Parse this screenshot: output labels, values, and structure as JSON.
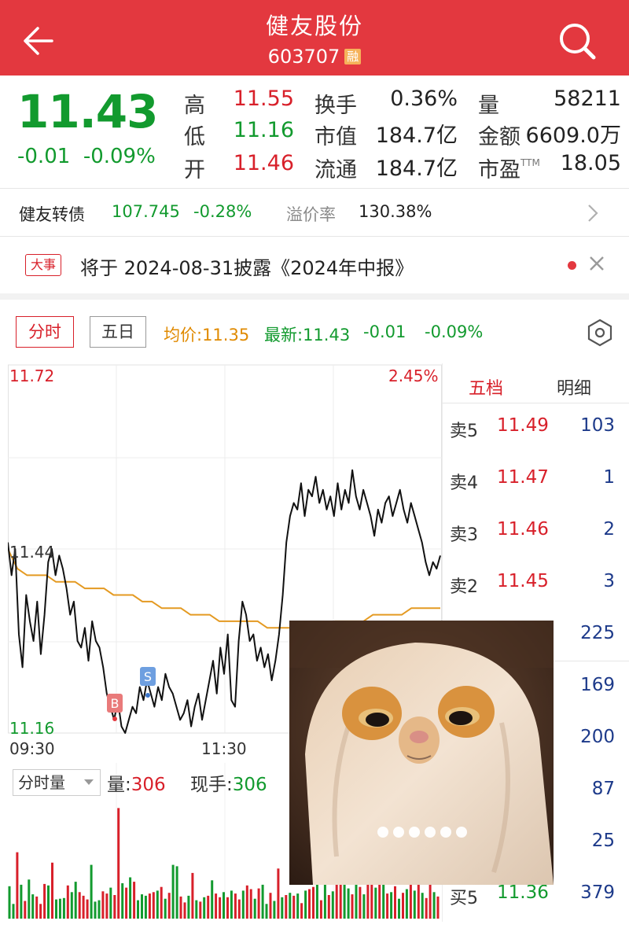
{
  "header": {
    "title": "健友股份",
    "code": "603707",
    "badge": "融"
  },
  "quote": {
    "price": "11.43",
    "change": "-0.01",
    "change_pct": "-0.09%",
    "stats": [
      {
        "label": "高",
        "value": "11.55",
        "color": "#d8202a"
      },
      {
        "label": "低",
        "value": "11.16",
        "color": "#129a2e"
      },
      {
        "label": "开",
        "value": "11.46",
        "color": "#d8202a"
      },
      {
        "label": "换手",
        "value": "0.36%",
        "color": "#222222"
      },
      {
        "label": "市值",
        "value": "184.7亿",
        "color": "#222222"
      },
      {
        "label": "流通",
        "value": "184.7亿",
        "color": "#222222"
      },
      {
        "label": "量",
        "value": "58211",
        "color": "#222222"
      },
      {
        "label": "金额",
        "value": "6609.0万",
        "color": "#222222"
      },
      {
        "label": "市盈",
        "value": "18.05",
        "color": "#222222",
        "sup": "TTM"
      }
    ]
  },
  "bond": {
    "name": "健友转债",
    "price": "107.745",
    "change_pct": "-0.28%",
    "premium_label": "溢价率",
    "premium": "130.38%"
  },
  "event": {
    "badge": "大事",
    "text": "将于 2024-08-31披露《2024年中报》"
  },
  "chart_tabs": {
    "intraday": "分时",
    "five_day": "五日",
    "avg_price": "均价:11.35",
    "latest": "最新:11.43",
    "latest_change": "-0.01",
    "latest_pct": "-0.09%"
  },
  "chart_labels": {
    "y_high": "11.72",
    "y_prev_close": "11.44",
    "y_low": "11.16",
    "pct_high": "2.45%",
    "time_start": "09:30",
    "time_mid": "11:30",
    "marker_buy": "B",
    "marker_sell": "S"
  },
  "volume": {
    "mode": "分时量",
    "vol_label": "量:",
    "vol_value": "306",
    "xianshou_label": "现手:",
    "xianshou_value": "306"
  },
  "order_book": {
    "tab_five": "五档",
    "tab_detail": "明细",
    "rows": [
      {
        "label": "卖5",
        "price": "11.49",
        "vol": "103",
        "color": "#d8202a"
      },
      {
        "label": "卖4",
        "price": "11.47",
        "vol": "1",
        "color": "#d8202a"
      },
      {
        "label": "卖3",
        "price": "11.46",
        "vol": "2",
        "color": "#d8202a"
      },
      {
        "label": "卖2",
        "price": "11.45",
        "vol": "3",
        "color": "#d8202a"
      },
      {
        "label": "",
        "price": "",
        "vol": "225",
        "color": "#d8202a"
      },
      {
        "label": "",
        "price": "",
        "vol": "169",
        "color": "#129a2e"
      },
      {
        "label": "",
        "price": "",
        "vol": "200",
        "color": "#129a2e"
      },
      {
        "label": "",
        "price": "",
        "vol": "87",
        "color": "#129a2e"
      },
      {
        "label": "",
        "price": "",
        "vol": "25",
        "color": "#129a2e"
      },
      {
        "label": "买5",
        "price": "11.36",
        "vol": "379",
        "color": "#129a2e"
      }
    ]
  },
  "chart_data": {
    "type": "line",
    "ylim": [
      11.16,
      11.72
    ],
    "prev_close": 11.44,
    "series": [
      {
        "name": "",
        "color": "#111111",
        "values": [
          11.45,
          11.4,
          11.44,
          11.31,
          11.26,
          11.37,
          11.33,
          11.3,
          11.36,
          11.28,
          11.34,
          11.42,
          11.44,
          11.4,
          11.43,
          11.41,
          11.38,
          11.34,
          11.36,
          11.3,
          11.29,
          11.32,
          11.27,
          11.33,
          11.3,
          11.29,
          11.26,
          11.22,
          11.2,
          11.18,
          11.21,
          11.17,
          11.16,
          11.18,
          11.2,
          11.19,
          11.23,
          11.21,
          11.24,
          11.22,
          11.2,
          11.23,
          11.21,
          11.25,
          11.23,
          11.22,
          11.2,
          11.18,
          11.19,
          11.21,
          11.17,
          11.2,
          11.22,
          11.18,
          11.21,
          11.24,
          11.27,
          11.22,
          11.29,
          11.25,
          11.31,
          11.21,
          11.2,
          11.3,
          11.36,
          11.34,
          11.3,
          11.31,
          11.27,
          11.29,
          11.26,
          11.28,
          11.24,
          11.27,
          11.31,
          11.37,
          11.45,
          11.49,
          11.51,
          11.5,
          11.54,
          11.49,
          11.53,
          11.52,
          11.55,
          11.51,
          11.53,
          11.5,
          11.52,
          11.49,
          11.54,
          11.5,
          11.53,
          11.51,
          11.56,
          11.52,
          11.5,
          11.53,
          11.51,
          11.49,
          11.46,
          11.5,
          11.48,
          11.51,
          11.52,
          11.49,
          11.51,
          11.53,
          11.5,
          11.48,
          11.51,
          11.49,
          11.47,
          11.45,
          11.42,
          11.4,
          11.42,
          11.41,
          11.43
        ]
      },
      {
        "name": "",
        "color": "#e49a22",
        "values": [
          11.44,
          11.41,
          11.4,
          11.4,
          11.4,
          11.39,
          11.39,
          11.39,
          11.38,
          11.38,
          11.38,
          11.37,
          11.37,
          11.37,
          11.36,
          11.36,
          11.35,
          11.35,
          11.35,
          11.34,
          11.34,
          11.34,
          11.33,
          11.33,
          11.33,
          11.33,
          11.33,
          11.32,
          11.32,
          11.32,
          11.32,
          11.32,
          11.32,
          11.32,
          11.33,
          11.33,
          11.33,
          11.33,
          11.34,
          11.34,
          11.34,
          11.34,
          11.35,
          11.35,
          11.35,
          11.35
        ]
      }
    ]
  },
  "volume_data": {
    "type": "bar",
    "values": [
      44,
      20,
      90,
      46,
      24,
      53,
      33,
      30,
      20,
      47,
      45,
      76,
      26,
      27,
      28,
      45,
      36,
      50,
      36,
      31,
      26,
      73,
      23,
      25,
      37,
      34,
      42,
      32,
      150,
      48,
      42,
      56,
      50,
      25,
      33,
      31,
      34,
      36,
      38,
      43,
      27,
      35,
      73,
      71,
      30,
      22,
      31,
      62,
      25,
      23,
      29,
      31,
      52,
      34,
      29,
      36,
      29,
      38,
      34,
      26,
      38,
      45,
      40,
      27,
      41,
      46,
      20,
      35,
      24,
      68,
      29,
      32,
      35,
      31,
      34,
      21,
      38,
      40,
      43,
      56,
      25,
      86,
      32,
      37,
      68,
      51,
      70,
      41,
      33,
      75,
      43,
      33,
      136,
      55,
      42,
      85,
      54,
      34,
      36,
      44,
      27,
      35,
      40,
      62,
      38,
      130,
      35,
      28,
      140,
      36,
      30
    ],
    "colors": [
      "g",
      "g",
      "r",
      "g",
      "r",
      "g",
      "g",
      "r",
      "r",
      "r",
      "g",
      "r",
      "g",
      "g",
      "g",
      "r",
      "g",
      "g",
      "r",
      "r",
      "r",
      "g",
      "g",
      "g",
      "r",
      "r",
      "g",
      "r",
      "r",
      "g",
      "r",
      "g",
      "r",
      "g",
      "g",
      "g",
      "r",
      "r",
      "g",
      "r",
      "g",
      "r",
      "g",
      "g",
      "r",
      "r",
      "g",
      "r",
      "g",
      "r",
      "g",
      "r",
      "g",
      "r",
      "r",
      "g",
      "r",
      "g",
      "r",
      "r",
      "g",
      "r",
      "r",
      "g",
      "r",
      "g",
      "g",
      "r",
      "g",
      "r",
      "g",
      "r",
      "g",
      "r",
      "g",
      "r",
      "g",
      "r",
      "r",
      "g",
      "r",
      "g",
      "r",
      "g",
      "r",
      "r",
      "g",
      "g",
      "r",
      "g",
      "r",
      "g",
      "r",
      "r",
      "g",
      "r",
      "g",
      "r",
      "g",
      "r",
      "g",
      "r",
      "g",
      "r",
      "g",
      "r",
      "g",
      "r",
      "r",
      "g",
      "r"
    ]
  }
}
